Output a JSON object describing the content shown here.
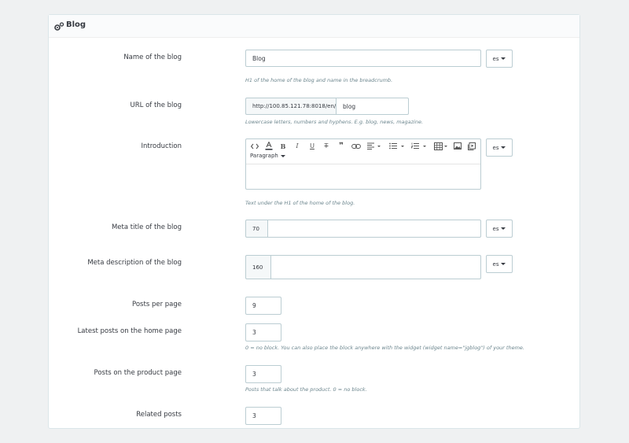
{
  "panel": {
    "title": "Blog",
    "icon": "cogs-icon"
  },
  "fields": {
    "name": {
      "label": "Name of the blog",
      "value": "Blog",
      "help": "H1 of the home of the blog and name in the breadcrumb.",
      "lang": "es"
    },
    "url": {
      "label": "URL of the blog",
      "prefix": "http://100.85.121.78:8018/en/",
      "value": "blog",
      "help": "Lowercase letters, numbers and hyphens. E.g. blog, news, magazine."
    },
    "introduction": {
      "label": "Introduction",
      "format": "Paragraph",
      "help": "Text under the H1 of the home of the blog.",
      "lang": "es"
    },
    "meta_title": {
      "label": "Meta title of the blog",
      "counter": "70",
      "value": "",
      "lang": "es"
    },
    "meta_description": {
      "label": "Meta description of the blog",
      "counter": "160",
      "value": "",
      "lang": "es"
    },
    "posts_per_page": {
      "label": "Posts per page",
      "value": "9"
    },
    "latest_posts_home": {
      "label": "Latest posts on the home page",
      "value": "3",
      "help": "0 = no block. You can also place the block anywhere with the widget (widget name=\"jgblog\") of your theme."
    },
    "posts_on_product": {
      "label": "Posts on the product page",
      "value": "3",
      "help": "Posts that talk about the product. 0 = no block."
    },
    "related_posts": {
      "label": "Related posts",
      "value": "3"
    }
  },
  "toolbar": {
    "buttons": [
      "source-code-icon",
      "text-color-icon",
      "bold-icon",
      "italic-icon",
      "underline-icon",
      "strikethrough-icon",
      "blockquote-icon",
      "link-icon",
      "align-icon",
      "bullet-list-icon",
      "numbered-list-icon",
      "table-icon",
      "image-icon",
      "media-icon"
    ]
  }
}
